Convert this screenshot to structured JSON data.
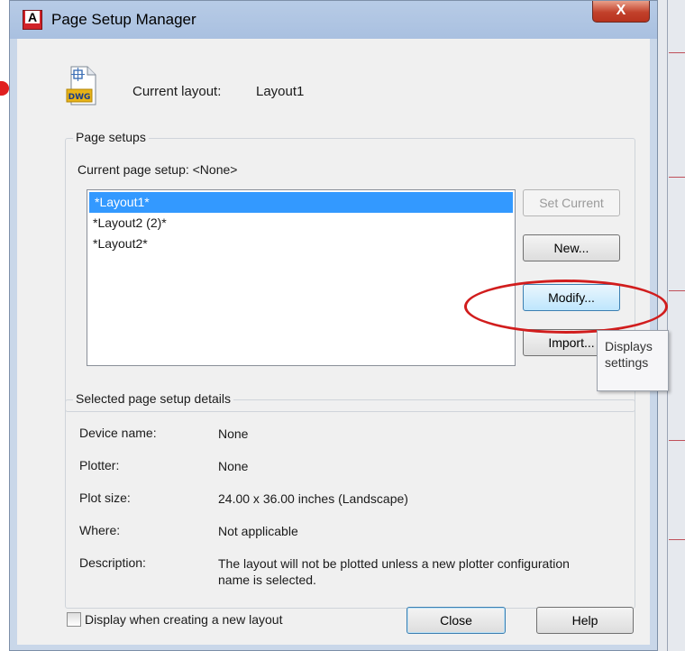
{
  "window": {
    "title": "Page Setup Manager",
    "close_glyph": "X"
  },
  "header": {
    "current_layout_label": "Current layout:",
    "current_layout_value": "Layout1",
    "icon": "dwg-file-icon",
    "icon_text": "DWG"
  },
  "page_setups": {
    "group_title": "Page setups",
    "current_page_setup": "Current page setup:  <None>",
    "items": [
      "*Layout1*",
      "*Layout2 (2)*",
      "*Layout2*"
    ],
    "selected_index": 0
  },
  "buttons": {
    "set_current": "Set Current",
    "new": "New...",
    "modify": "Modify...",
    "import": "Import...",
    "close": "Close",
    "help": "Help"
  },
  "tooltip": {
    "line1": "Displays",
    "line2": "settings"
  },
  "details": {
    "group_title": "Selected page setup details",
    "rows": [
      {
        "key": "Device name:",
        "value": "None"
      },
      {
        "key": "Plotter:",
        "value": "None"
      },
      {
        "key": "Plot size:",
        "value": "24.00 x 36.00 inches (Landscape)"
      },
      {
        "key": "Where:",
        "value": "Not applicable"
      },
      {
        "key": "Description:",
        "value": "The layout will not be plotted unless a new plotter configuration name is selected."
      }
    ]
  },
  "footer": {
    "checkbox_label": "Display when creating a new layout",
    "checkbox_checked": false
  },
  "colors": {
    "selection": "#3399ff",
    "annotation": "#d11d1d",
    "close_button": "#c2412b"
  }
}
